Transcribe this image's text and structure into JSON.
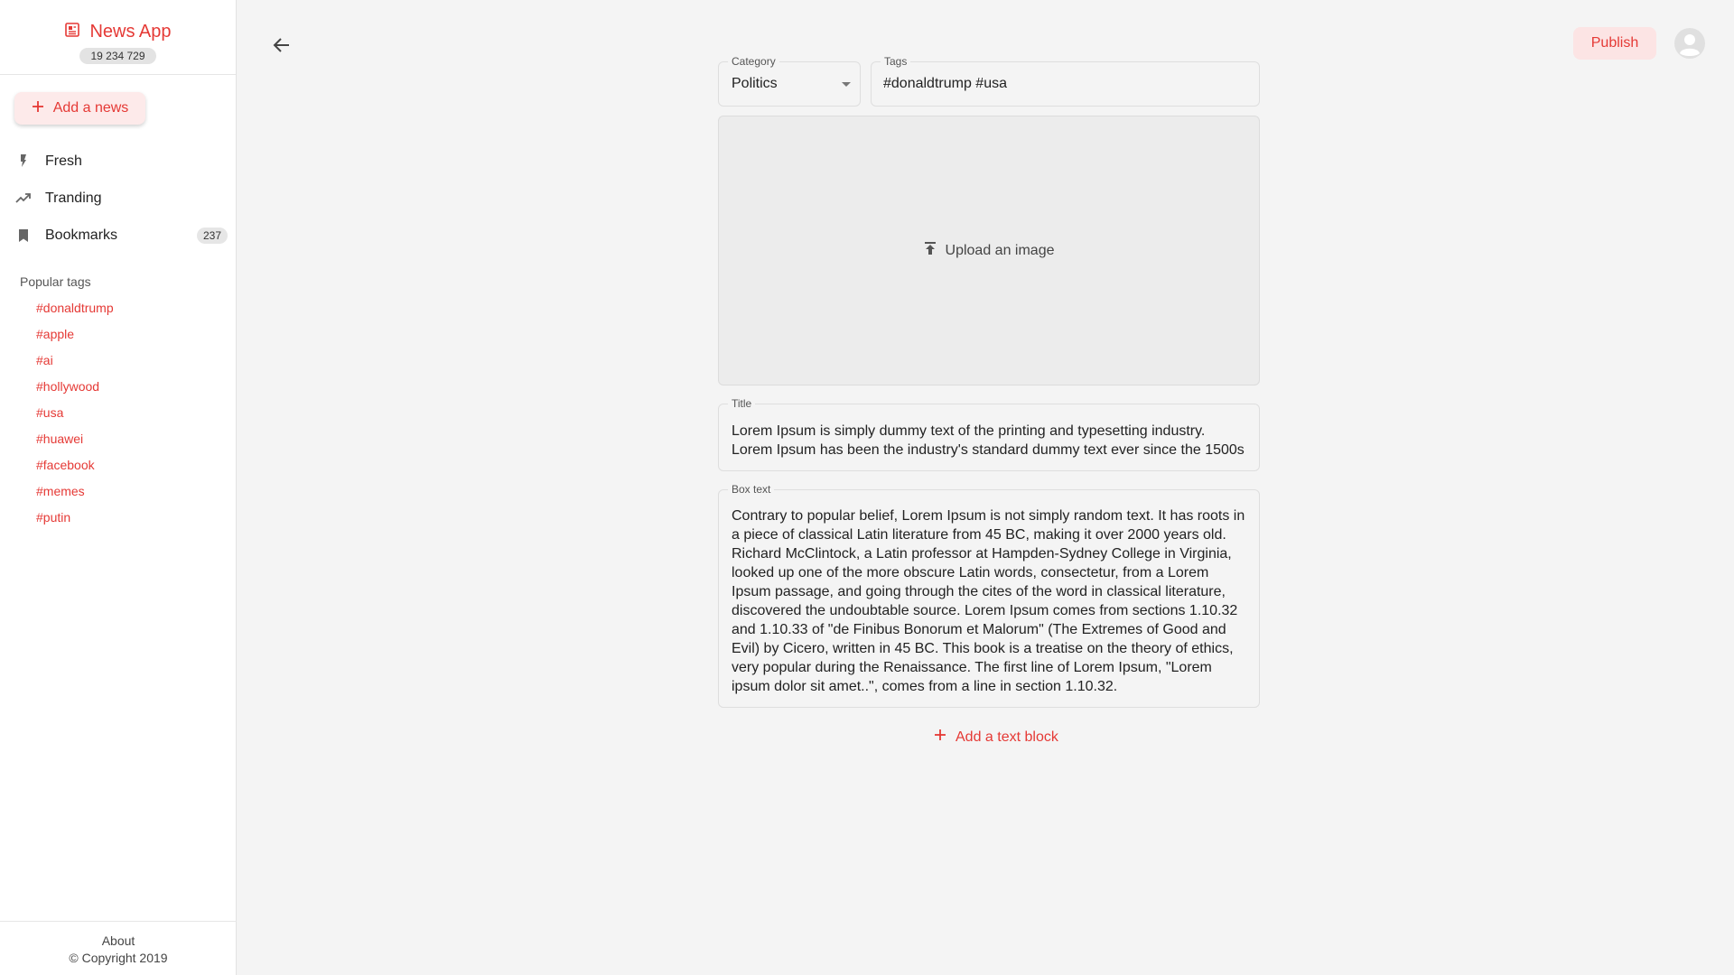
{
  "app": {
    "title": "News App",
    "count": "19 234 729"
  },
  "sidebar": {
    "add_news_label": "Add a news",
    "nav": [
      {
        "label": "Fresh",
        "icon": "lightning-icon"
      },
      {
        "label": "Tranding",
        "icon": "trending-up-icon"
      },
      {
        "label": "Bookmarks",
        "icon": "bookmark-icon",
        "badge": "237"
      }
    ],
    "popular_tags_heading": "Popular tags",
    "tags": [
      "#donaldtrump",
      "#apple",
      "#ai",
      "#hollywood",
      "#usa",
      "#huawei",
      "#facebook",
      "#memes",
      "#putin"
    ],
    "footer": {
      "about": "About",
      "copyright": "© Copyright 2019"
    }
  },
  "header": {
    "publish_label": "Publish"
  },
  "form": {
    "category": {
      "label": "Category",
      "value": "Politics"
    },
    "tags": {
      "label": "Tags",
      "value": "#donaldtrump #usa"
    },
    "upload_label": "Upload an image",
    "title": {
      "label": "Title",
      "value": "Lorem Ipsum is simply dummy text of the printing and typesetting industry. Lorem Ipsum has been the industry's standard dummy text ever since the 1500s"
    },
    "box_text": {
      "label": "Box text",
      "value": "Contrary to popular belief, Lorem Ipsum is not simply random text. It has roots in a piece of classical Latin literature from 45 BC, making it over 2000 years old. Richard McClintock, a Latin professor at Hampden-Sydney College in Virginia, looked up one of the more obscure Latin words, consectetur, from a Lorem Ipsum passage, and going through the cites of the word in classical literature, discovered the undoubtable source. Lorem Ipsum comes from sections 1.10.32 and 1.10.33 of \"de Finibus Bonorum et Malorum\" (The Extremes of Good and Evil) by Cicero, written in 45 BC. This book is a treatise on the theory of ethics, very popular during the Renaissance. The first line of Lorem Ipsum, \"Lorem ipsum dolor sit amet..\", comes from a line in section 1.10.32."
    },
    "add_block_label": "Add a text block"
  },
  "colors": {
    "accent": "#e53935",
    "accent_soft": "#fce4e4",
    "background": "#f4f4f4",
    "sidebar": "#ffffff"
  }
}
